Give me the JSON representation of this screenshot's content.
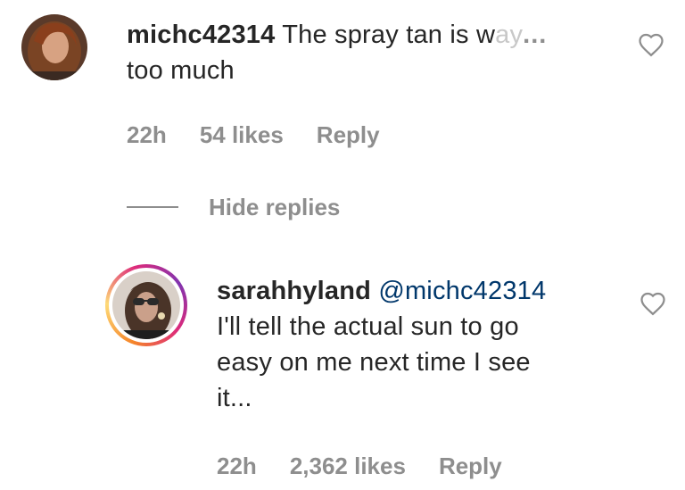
{
  "comment": {
    "username": "michc42314",
    "text_visible": "The spray tan is w",
    "text_faded": "ay",
    "text_ellipsis": "...",
    "text_line2": "too much",
    "time": "22h",
    "likes": "54 likes",
    "reply_label": "Reply",
    "like_icon": "heart-outline-icon"
  },
  "hide_replies_label": "Hide replies",
  "reply": {
    "username": "sarahhyland",
    "mention": "@michc42314",
    "line1": "I'll tell the actual sun to go",
    "line2": "easy on me next time I see",
    "line3": "it...",
    "time": "22h",
    "likes": "2,362 likes",
    "reply_label": "Reply",
    "like_icon": "heart-outline-icon"
  },
  "colors": {
    "text": "#262626",
    "secondary": "#8e8e8e",
    "mention": "#00376b",
    "story_ring_start": "#f58529",
    "story_ring_end": "#dd2a7b"
  }
}
